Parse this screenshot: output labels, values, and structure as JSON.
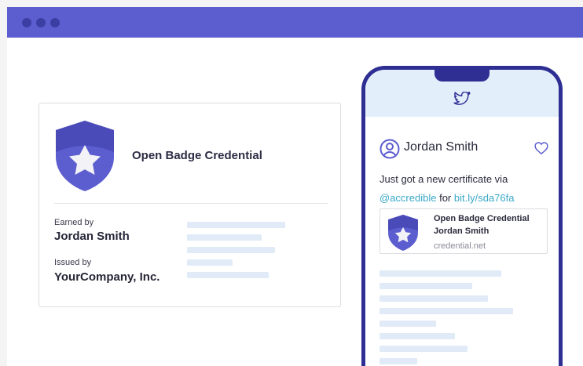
{
  "colors": {
    "titlebar": "#5c5dcf",
    "badge": "#5c5dcf",
    "phone_frame": "#2e2e93",
    "link": "#3aa8c8",
    "placeholder_bar": "#e1ebf8"
  },
  "credential_card": {
    "title": "Open Badge Credential",
    "earned_by_label": "Earned by",
    "earned_by_value": "Jordan Smith",
    "issued_by_label": "Issued by",
    "issued_by_value": "YourCompany, Inc."
  },
  "tweet": {
    "platform_icon": "twitter-icon",
    "author": "Jordan Smith",
    "text_line1": "Just got a new certificate via",
    "mention": "@accredible",
    "text_for": "for",
    "short_link": "bit.ly/sda76fa",
    "preview": {
      "title": "Open Badge Credential",
      "name": "Jordan Smith",
      "domain": "credential.net"
    }
  }
}
